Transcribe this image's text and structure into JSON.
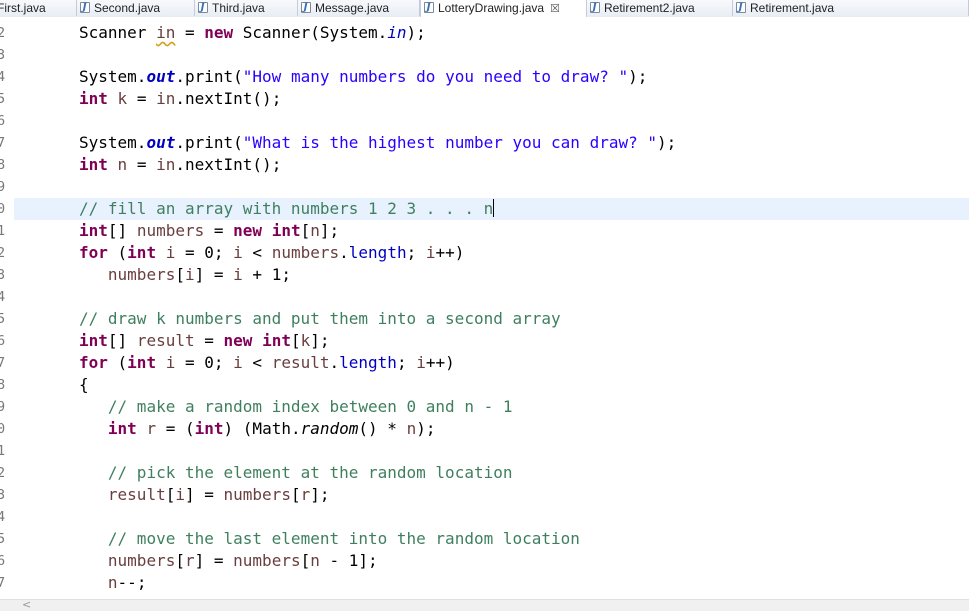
{
  "tabs": [
    {
      "label": "First.java",
      "active": false
    },
    {
      "label": "Second.java",
      "active": false
    },
    {
      "label": "Third.java",
      "active": false
    },
    {
      "label": "Message.java",
      "active": false
    },
    {
      "label": "LotteryDrawing.java",
      "active": true,
      "close": "☒"
    },
    {
      "label": "Retirement2.java",
      "active": false
    },
    {
      "label": "Retirement.java",
      "active": false
    }
  ],
  "editor": {
    "line_numbers": [
      "2",
      "3",
      "4",
      "5",
      "6",
      "7",
      "8",
      "9",
      "0",
      "1",
      "2",
      "3",
      "4",
      "5",
      "6",
      "7",
      "8",
      "9",
      "0",
      "1",
      "2",
      "3",
      "4",
      "5",
      "6",
      "7"
    ],
    "code_lines": [
      "Scanner in = new Scanner(System.in);",
      "",
      "System.out.print(\"How many numbers do you need to draw? \");",
      "int k = in.nextInt();",
      "",
      "System.out.print(\"What is the highest number you can draw? \");",
      "int n = in.nextInt();",
      "",
      "// fill an array with numbers 1 2 3 . . . n",
      "int[] numbers = new int[n];",
      "for (int i = 0; i < numbers.length; i++)",
      "   numbers[i] = i + 1;",
      "",
      "// draw k numbers and put them into a second array",
      "int[] result = new int[k];",
      "for (int i = 0; i < result.length; i++)",
      "{",
      "   // make a random index between 0 and n - 1",
      "   int r = (int) (Math.random() * n);",
      "",
      "   // pick the element at the random location",
      "   result[i] = numbers[r];",
      "",
      "   // move the last element into the random location",
      "   numbers[r] = numbers[n - 1];",
      "   n--;"
    ]
  },
  "scrollbar": {
    "left_arrow": "<"
  }
}
